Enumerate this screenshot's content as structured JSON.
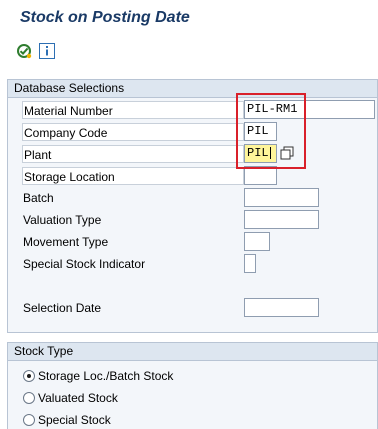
{
  "window": {
    "title": "Stock on Posting Date"
  },
  "toolbar": {
    "buttons": [
      {
        "icon": "execute-icon"
      },
      {
        "icon": "info-icon"
      }
    ]
  },
  "database_selections": {
    "header": "Database Selections",
    "fields": [
      {
        "label": "Material Number",
        "value": "PIL-RM1"
      },
      {
        "label": "Company Code",
        "value": "PIL"
      },
      {
        "label": "Plant",
        "value": "PIL"
      },
      {
        "label": "Storage Location",
        "value": ""
      },
      {
        "label": "Batch",
        "value": ""
      },
      {
        "label": "Valuation Type",
        "value": ""
      },
      {
        "label": "Movement Type",
        "value": ""
      },
      {
        "label": "Special Stock Indicator",
        "value": ""
      },
      {
        "label": "Selection Date",
        "value": ""
      }
    ]
  },
  "stock_type": {
    "header": "Stock Type",
    "options": [
      {
        "label": "Storage Loc./Batch Stock",
        "selected": true
      },
      {
        "label": "Valuated Stock",
        "selected": false
      },
      {
        "label": "Special Stock",
        "selected": false
      }
    ]
  },
  "colors": {
    "title": "#1a3a66",
    "group_header_bg": "#dde6f0",
    "group_bg": "#f3f6fa",
    "focus_field": "#fff59a",
    "annotation_box": "#d9202a"
  }
}
